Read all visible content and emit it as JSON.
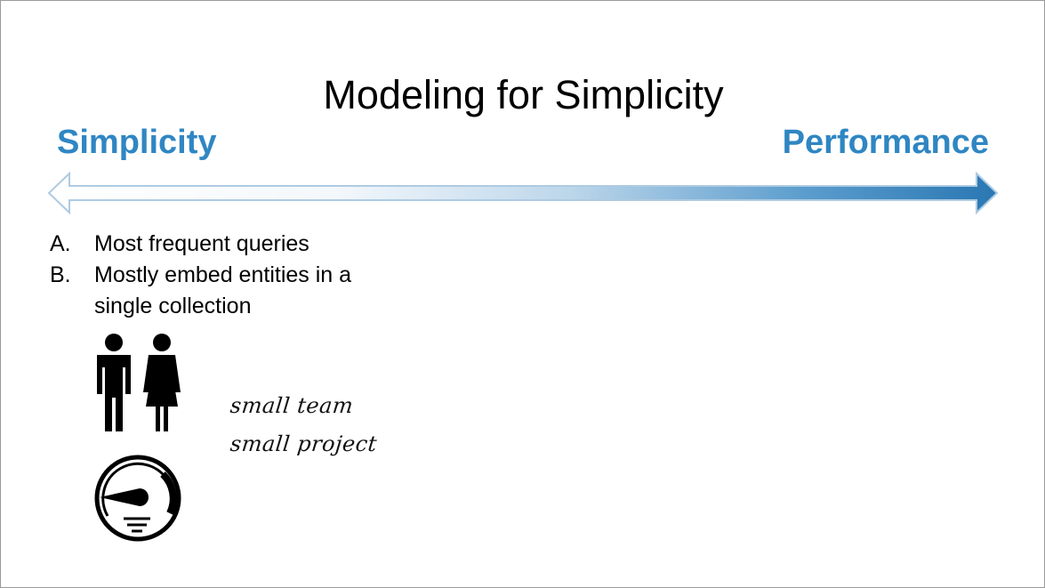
{
  "slide": {
    "title": "Modeling for Simplicity",
    "spectrum": {
      "left_label": "Simplicity",
      "right_label": "Performance",
      "accent_color": "#2f86c3"
    },
    "points": [
      {
        "marker": "A.",
        "text": "Most frequent queries"
      },
      {
        "marker": "B.",
        "text": "Mostly embed entities in a single collection"
      }
    ],
    "icons": [
      "people-icon",
      "gauge-icon"
    ],
    "notes": [
      "small team",
      "small project"
    ]
  }
}
